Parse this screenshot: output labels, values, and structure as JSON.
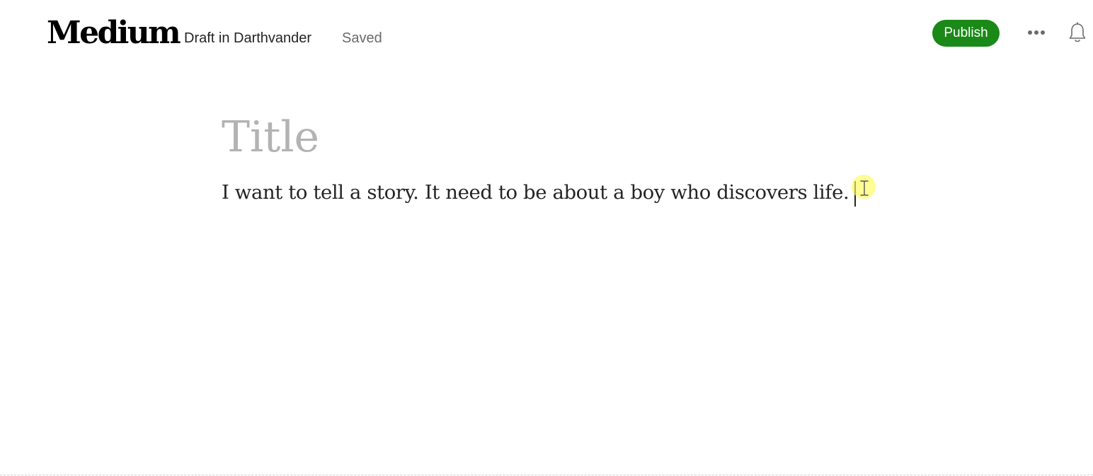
{
  "header": {
    "logo_text": "Medium",
    "draft_location": "Draft in Darthvander",
    "save_status": "Saved",
    "publish_label": "Publish",
    "more_icon": "more-horizontal-icon",
    "notifications_icon": "bell-icon"
  },
  "editor": {
    "title_placeholder": "Title",
    "body_text": "I want to tell a story. It need to be about a boy who discovers life."
  },
  "colors": {
    "publish_green": "#1a8917",
    "placeholder_gray": "#b3b3b3",
    "text": "#242424",
    "muted_text": "#6b6b6b"
  }
}
